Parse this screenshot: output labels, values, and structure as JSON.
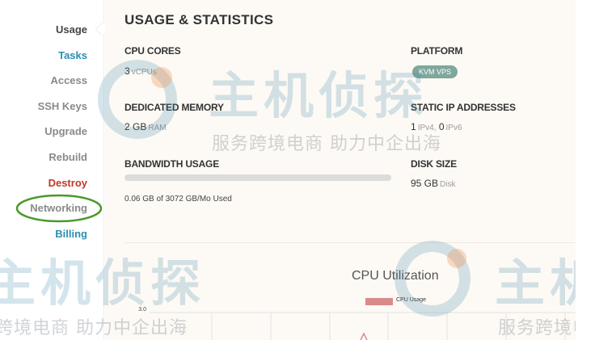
{
  "sidebar": {
    "items": [
      {
        "label": "Usage"
      },
      {
        "label": "Tasks"
      },
      {
        "label": "Access"
      },
      {
        "label": "SSH Keys"
      },
      {
        "label": "Upgrade"
      },
      {
        "label": "Rebuild"
      },
      {
        "label": "Destroy"
      },
      {
        "label": "Networking"
      },
      {
        "label": "Billing"
      }
    ],
    "active": "Usage",
    "highlighted": "Networking"
  },
  "main": {
    "title": "USAGE & STATISTICS",
    "cpu": {
      "label": "CPU CORES",
      "value": "3",
      "unit": "vCPUs"
    },
    "platform": {
      "label": "PLATFORM",
      "badge": "KVM VPS"
    },
    "memory": {
      "label": "DEDICATED MEMORY",
      "value": "2 GB",
      "unit": "RAM"
    },
    "static_ip": {
      "label": "STATIC IP ADDRESSES",
      "ipv4": "1",
      "ipv4_unit": "IPv4,",
      "ipv6": "0",
      "ipv6_unit": "IPv6"
    },
    "bandwidth": {
      "label": "BANDWIDTH USAGE",
      "used_text": "0.06 GB of 3072 GB/Mo Used",
      "used_fraction": 2e-05
    },
    "disk": {
      "label": "DISK SIZE",
      "value": "95 GB",
      "unit": "Disk"
    }
  },
  "chart_data": {
    "type": "line",
    "title": "CPU Utilization",
    "series": [
      {
        "name": "CPU Usage",
        "values": []
      }
    ],
    "y_ticks": [
      "3.0"
    ],
    "grid": true,
    "legend": "top-center"
  },
  "watermark": {
    "brand": "主机侦探",
    "slogan": "服务跨境电商 助力中企出海",
    "slogan_partial_left": "跨境电商 助力中企出海",
    "slogan_partial_right": "服务跨境电"
  },
  "colors": {
    "accent": "#2b8fb3",
    "destroy": "#c0392b",
    "badge": "#7fa79c",
    "highlight_circle": "#4a9a2a",
    "legend": "#d98b8b"
  }
}
